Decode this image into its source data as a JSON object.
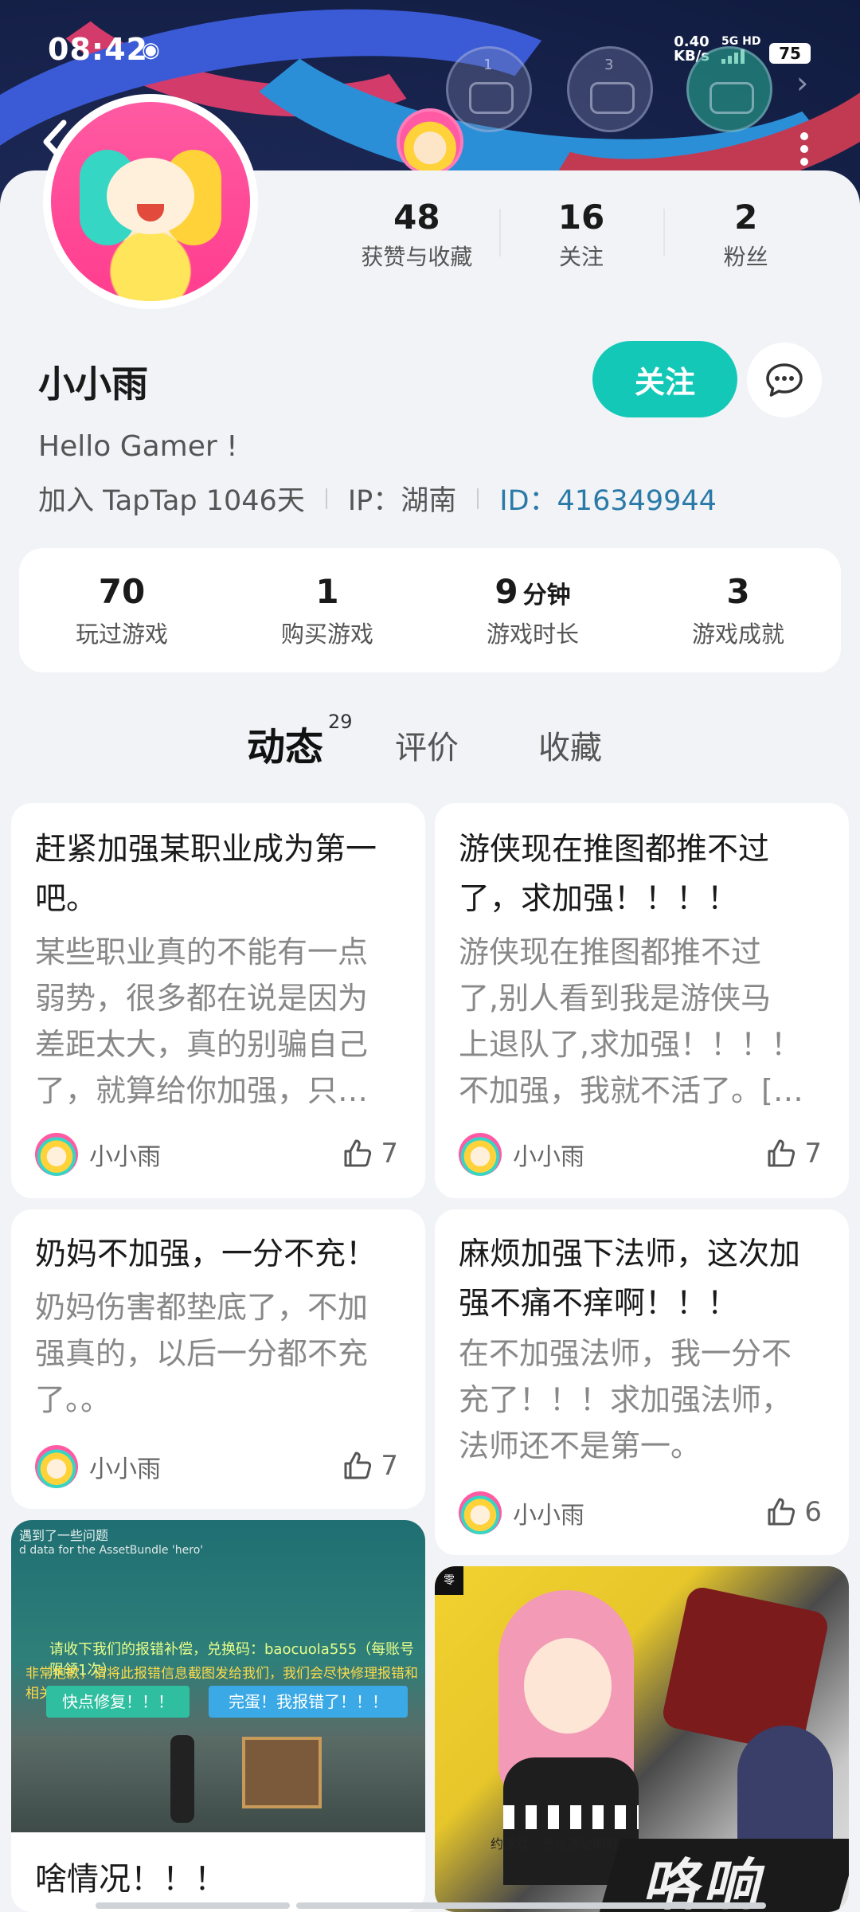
{
  "status_bar": {
    "time": "08:42",
    "speed_value": "0.40",
    "speed_unit": "KB/s",
    "network": "5G HD",
    "battery": "75"
  },
  "profile": {
    "name": "小小雨",
    "bio": "Hello Gamer !",
    "join": "加入 TapTap 1046天",
    "ip": "IP：湖南",
    "id": "ID：416349944",
    "follow_label": "关注"
  },
  "top_stats": [
    {
      "value": "48",
      "label": "获赞与收藏"
    },
    {
      "value": "16",
      "label": "关注"
    },
    {
      "value": "2",
      "label": "粉丝"
    }
  ],
  "game_stats": [
    {
      "value": "70",
      "unit": "",
      "label": "玩过游戏"
    },
    {
      "value": "1",
      "unit": "",
      "label": "购买游戏"
    },
    {
      "value": "9",
      "unit": "分钟",
      "label": "游戏时长"
    },
    {
      "value": "3",
      "unit": "",
      "label": "游戏成就"
    }
  ],
  "tabs": [
    {
      "label": "动态",
      "count": "29"
    },
    {
      "label": "评价"
    },
    {
      "label": "收藏"
    }
  ],
  "posts": [
    {
      "title_lines": [
        "赶紧加强某职业成为第一",
        "吧。"
      ],
      "body_lines": [
        "某些职业真的不能有一点",
        "弱势，很多都在说是因为",
        "差距太大，真的别骗自己",
        "了，就算给你加强，只…"
      ],
      "author": "小小雨",
      "likes": "7"
    },
    {
      "title_lines": [
        "游侠现在推图都推不过",
        "了，求加强！！！！"
      ],
      "body_lines": [
        "游侠现在推图都推不过",
        "了,别人看到我是游侠马",
        "上退队了,求加强！！！！",
        "不加强，我就不活了。[…"
      ],
      "author": "小小雨",
      "likes": "7"
    },
    {
      "title_lines": [
        "奶妈不加强，一分不充！"
      ],
      "body_lines": [
        "奶妈伤害都垫底了，不加",
        "强真的，以后一分都不充",
        "了。。"
      ],
      "author": "小小雨",
      "likes": "7"
    },
    {
      "title_lines": [
        "麻烦加强下法师，这次加",
        "强不痛不痒啊！！！"
      ],
      "body_lines": [
        "在不加强法师，我一分不",
        "充了！！！求加强法师，",
        "法师还不是第一。"
      ],
      "author": "小小雨",
      "likes": "6"
    }
  ],
  "image_post_1": {
    "line1": "遇到了一些问题",
    "line2": "d data for the AssetBundle 'hero'",
    "notice1": "请收下我们的报错补偿，兑换码：baocuola555（每账号限领1次）",
    "notice2": "非常抱歉，请将此报错信息截图发给我们，我们会尽快修理报错和相关负责人员。",
    "btn1": "快点修复！！！",
    "btn2": "完蛋！我报错了！！！",
    "title": "啥情况！！！"
  },
  "image_post_2": {
    "corner": "零",
    "logo": "咯响",
    "small": "约游戏、参与活动即可"
  },
  "colors": {
    "accent": "#14c8b8",
    "id_link": "#2a7aa8"
  }
}
